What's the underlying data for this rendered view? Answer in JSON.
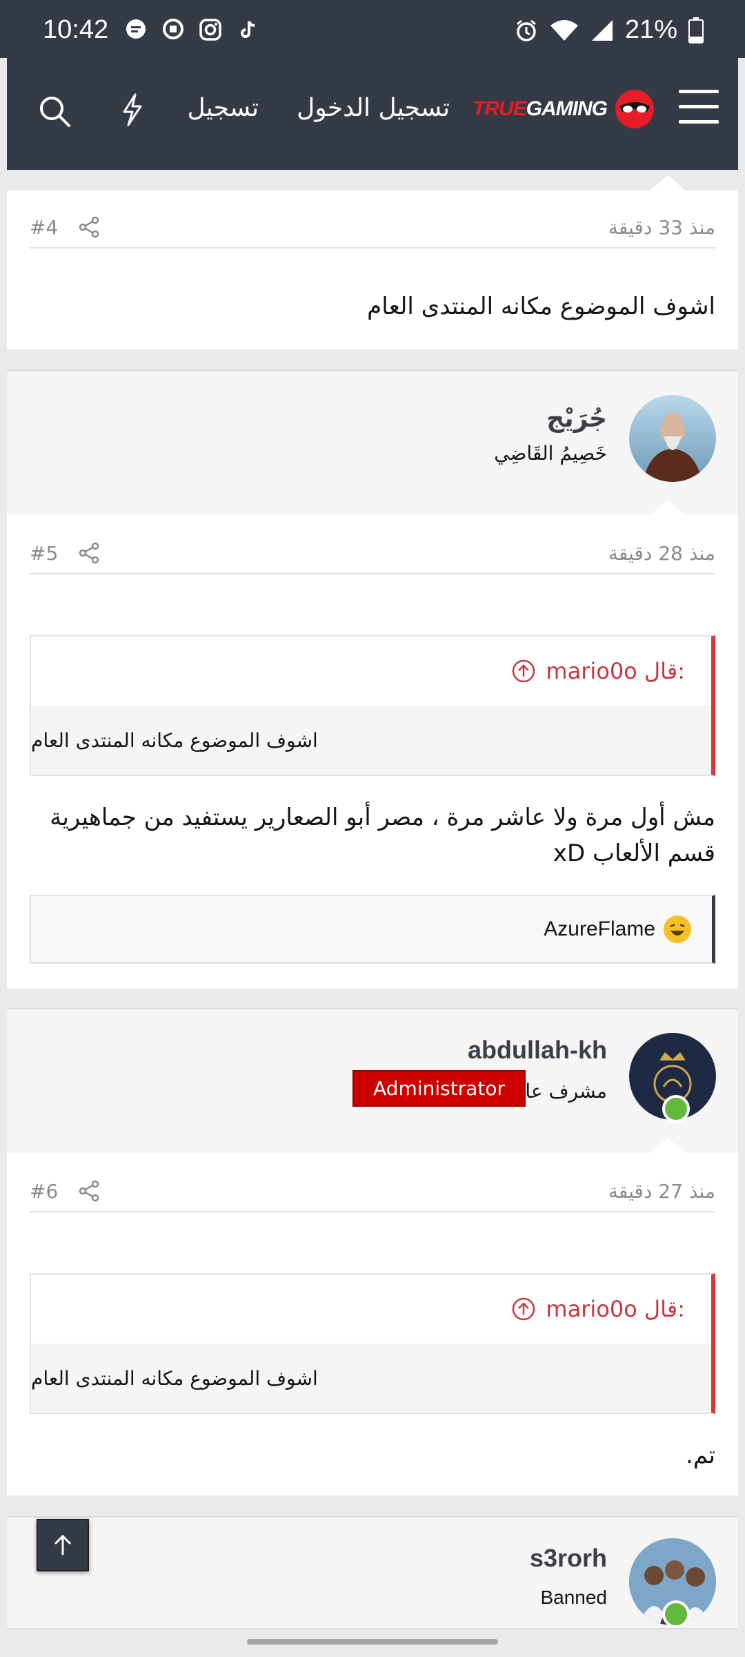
{
  "status_bar": {
    "time": "10:42",
    "battery": "21%",
    "icons": [
      "message-bubble-icon",
      "chat-icon",
      "instagram-icon",
      "tiktok-icon",
      "alarm-icon",
      "wifi-icon",
      "signal-icon",
      "battery-icon"
    ]
  },
  "header": {
    "logo_true": "TRUE",
    "logo_gaming": "GAMING",
    "login": "تسجيل الدخول",
    "register": "تسجيل"
  },
  "posts": [
    {
      "number": "#4",
      "date": "منذ 33 دقيقة",
      "text": "اشوف الموضوع مكانه المنتدى العام"
    },
    {
      "author": "جُرَيْج",
      "author_title": "خَصِيمُ القَاضِي",
      "number": "#5",
      "date": "منذ 28 دقيقة",
      "quote_author": "mario0o قال:",
      "quote_text": "اشوف الموضوع مكانه المنتدى العام",
      "text": "مش أول مرة ولا عاشر مرة ، مصر أبو الصعارير يستفيد من جماهيرية قسم الألعاب xD",
      "reaction_user": "AzureFlame"
    },
    {
      "author": "abdullah-kh",
      "author_title": "مشرف عام",
      "badge": "Administrator",
      "number": "#6",
      "date": "منذ 27 دقيقة",
      "quote_author": "mario0o قال:",
      "quote_text": "اشوف الموضوع مكانه المنتدى العام",
      "text": "تم."
    },
    {
      "author": "s3rorh",
      "author_title": "Banned"
    }
  ],
  "colors": {
    "header_bg": "#343a46",
    "quote_accent": "#d9373b",
    "admin_badge": "#cc0000",
    "online": "#63b93b"
  }
}
